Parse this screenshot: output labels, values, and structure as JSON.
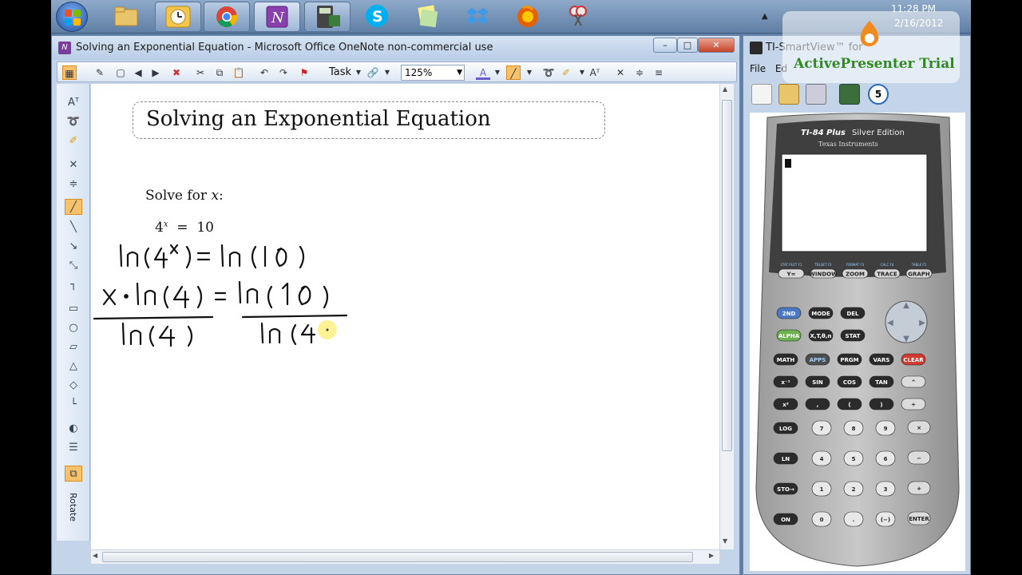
{
  "taskbar": {
    "clock_time": "11:28 PM",
    "clock_date": "2/16/2012",
    "apps": [
      "start-orb",
      "explorer",
      "outlook",
      "chrome",
      "onenote",
      "ti-smartview",
      "skype",
      "sticky-notes",
      "dropbox",
      "firefox",
      "snipping-tool"
    ]
  },
  "onenote": {
    "window_title": "Solving an Exponential Equation - Microsoft Office OneNote non-commercial use",
    "window_buttons": {
      "minimize": "–",
      "maximize": "□",
      "close": "✕"
    },
    "toolbar": {
      "task_label": "Task",
      "zoom_value": "125%"
    },
    "rotate_label": "Rotate",
    "page": {
      "title": "Solving an Exponential Equation",
      "prompt_text": "Solve for ",
      "prompt_var": "x",
      "prompt_colon": ":",
      "equation_base": "4",
      "equation_exp": "x",
      "equation_rest": "  =  10"
    },
    "handwriting": {
      "line1": "ln(4^x) = ln(10)",
      "line2_numerator_left": "x·ln(4)",
      "line2_numerator_right": "ln(10)",
      "line2_denominator_left": "ln(4)",
      "line2_denominator_right": "ln(4"
    }
  },
  "calculator": {
    "window_title": "TI-SmartView™ for",
    "menu": [
      "File",
      "Ed"
    ],
    "model": "TI-84 Plus",
    "edition": "Silver Edition",
    "brand": "Texas Instruments",
    "keys": {
      "function_row": [
        "Y=",
        "WINDOW",
        "ZOOM",
        "TRACE",
        "GRAPH"
      ],
      "function_labels": [
        "STAT PLOT F1",
        "TBLSET F2",
        "FORMAT F3",
        "CALC F4",
        "TABLE F5"
      ],
      "row1": [
        "2ND",
        "MODE",
        "DEL"
      ],
      "row2": [
        "ALPHA",
        "X,T,θ,n",
        "STAT"
      ],
      "row3": [
        "MATH",
        "APPS",
        "PRGM",
        "VARS",
        "CLEAR"
      ],
      "row4": [
        "x⁻¹",
        "SIN",
        "COS",
        "TAN",
        "^"
      ],
      "row5": [
        "x²",
        ",",
        "(",
        ")",
        "÷"
      ],
      "row6": [
        "LOG",
        "7",
        "8",
        "9",
        "×"
      ],
      "row7": [
        "LN",
        "4",
        "5",
        "6",
        "−"
      ],
      "row8": [
        "STO→",
        "1",
        "2",
        "3",
        "+"
      ],
      "row9": [
        "ON",
        "0",
        ".",
        "(−)",
        "ENTER"
      ]
    }
  },
  "watermark": {
    "text": "ActivePresenter Trial"
  },
  "colors": {
    "ink": "#111111",
    "highlight": "#ffef7a",
    "title_bar": "#c4d5ea",
    "calc_body": "#5a5a5a",
    "calc_key_dark": "#2b2b2b",
    "calc_key_light": "#e8e8e8",
    "clear_key": "#d23a2e",
    "second_key": "#4a78c2",
    "alpha_key": "#6bb24f"
  }
}
